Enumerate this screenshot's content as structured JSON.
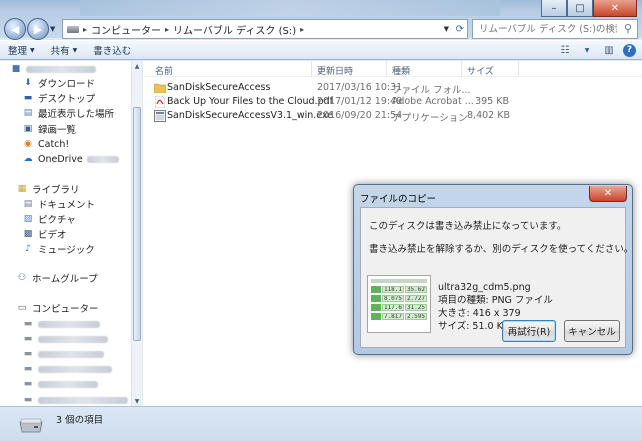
{
  "address_bar": {
    "breadcrumbs": [
      "コンピューター",
      "リムーバブル ディスク (S:)"
    ],
    "search_placeholder": "リムーバブル ディスク (S:)の検索"
  },
  "toolbar": {
    "organize_label": "整理",
    "share_label": "共有",
    "burn_label": "書き込む"
  },
  "nav_pane": {
    "favorites": [
      {
        "label": "ダウンロード",
        "icon": "download-folder-icon"
      },
      {
        "label": "デスクトップ",
        "icon": "desktop-icon"
      },
      {
        "label": "最近表示した場所",
        "icon": "recent-places-icon"
      },
      {
        "label": "録画一覧",
        "icon": "recordings-icon"
      },
      {
        "label": "Catch!",
        "icon": "catch-icon"
      },
      {
        "label": "OneDrive",
        "icon": "onedrive-icon"
      }
    ],
    "libraries_label": "ライブラリ",
    "libraries": [
      {
        "label": "ドキュメント",
        "icon": "documents-icon"
      },
      {
        "label": "ピクチャ",
        "icon": "pictures-icon"
      },
      {
        "label": "ビデオ",
        "icon": "videos-icon"
      },
      {
        "label": "ミュージック",
        "icon": "music-icon"
      }
    ],
    "homegroup_label": "ホームグループ",
    "computer_label": "コンピューター"
  },
  "file_list": {
    "columns": {
      "name": "名前",
      "modified": "更新日時",
      "type": "種類",
      "size": "サイズ"
    },
    "rows": [
      {
        "name": "SanDiskSecureAccess",
        "modified": "2017/03/16 10:31",
        "type": "ファイル フォル...",
        "size": "",
        "icon": "folder-icon"
      },
      {
        "name": "Back Up Your Files to the Cloud.pdf",
        "modified": "2017/01/12 19:49",
        "type": "Adobe Acrobat ...",
        "size": "395 KB",
        "icon": "pdf-icon"
      },
      {
        "name": "SanDiskSecureAccessV3.1_win.exe",
        "modified": "2016/09/20 21:54",
        "type": "アプリケーション",
        "size": "8,402 KB",
        "icon": "exe-icon"
      }
    ]
  },
  "status_bar": {
    "item_count": "3 個の項目"
  },
  "dialog": {
    "title": "ファイルのコピー",
    "message_line1": "このディスクは書き込み禁止になっています。",
    "message_line2": "書き込み禁止を解除するか、別のディスクを使ってください。",
    "file_name": "ultra32g_cdm5.png",
    "file_type": "項目の種類: PNG ファイル",
    "dimensions": "大きさ: 416 x 379",
    "file_size": "サイズ: 51.0 KB",
    "retry_label": "再試行(R)",
    "cancel_label": "キャンセル",
    "thumbnail_values": [
      [
        "118.1",
        "35.62"
      ],
      [
        "8.075",
        "2.727"
      ],
      [
        "117.6",
        "31.25"
      ],
      [
        "7.817",
        "2.595"
      ]
    ]
  }
}
